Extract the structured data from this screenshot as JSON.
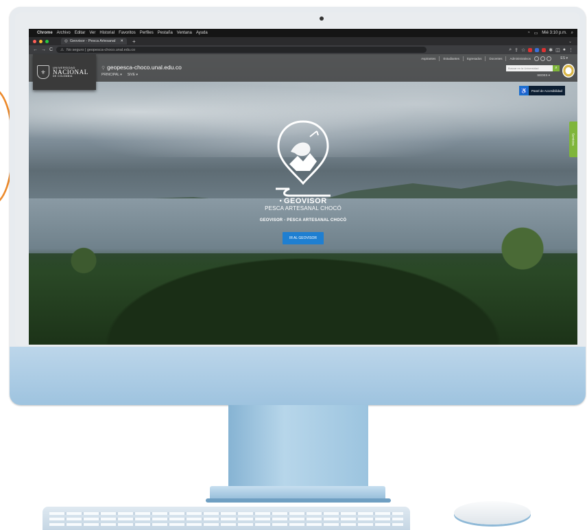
{
  "menubar": {
    "items": [
      "Chrome",
      "Archivo",
      "Editar",
      "Ver",
      "Historial",
      "Favoritos",
      "Perfiles",
      "Pestaña",
      "Ventana",
      "Ayuda"
    ],
    "status": "Mié 3:10 p.m."
  },
  "browser": {
    "tab_title": "Geovisor - Pesca Artesanal",
    "address": "No seguro | geopesca-choco.unal.edu.co",
    "colors": {
      "close": "#ff5f57",
      "minimize": "#febc2e",
      "maximize": "#28c840"
    }
  },
  "site": {
    "logo": {
      "line1": "UNIVERSIDAD",
      "line2": "NACIONAL",
      "line3": "DE COLOMBIA"
    },
    "domain": "geopesca-choco.unal.edu.co",
    "submenu": [
      "PRINCIPAL ▾",
      "SIVE ▾"
    ],
    "topnav": [
      "Aspirantes",
      "Estudiantes",
      "Egresados",
      "Docentes",
      "Administrativos"
    ],
    "lang": "ES ▾",
    "search_placeholder": "Buscar en la Universidad",
    "sedes": "SEDES ▾",
    "accessibility_label": "Panel de Accesibilidad",
    "servicios": "Servicios",
    "brand": "GEOVISOR",
    "brand_sub": "PESCA ARTESANAL CHOCÓ",
    "hero_title": "GEOVISOR - PESCA ARTESANAL CHOCÓ",
    "cta_label": "IR AL GEOVISOR",
    "accent_green": "#7fb53b",
    "accent_blue": "#1f7fd1"
  }
}
